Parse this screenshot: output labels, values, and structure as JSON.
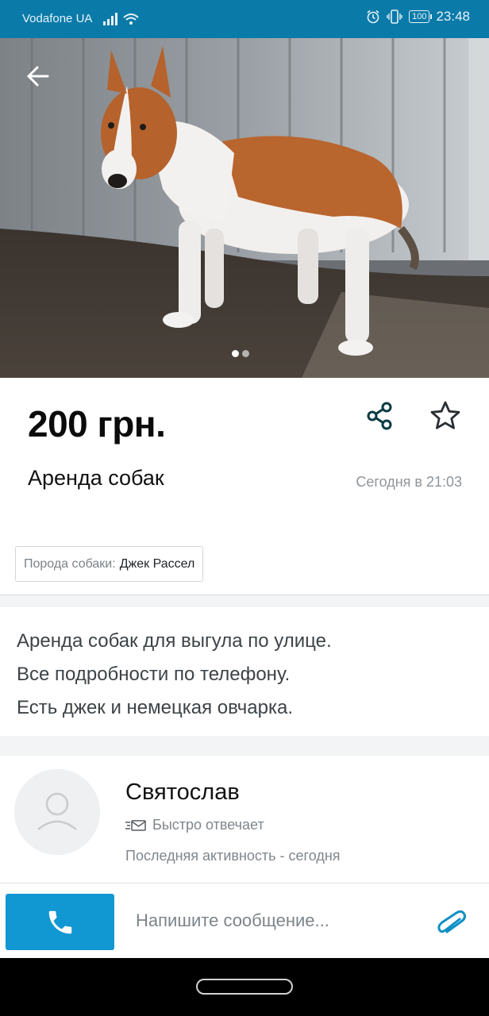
{
  "status_bar": {
    "carrier": "Vodafone UA",
    "battery": "100",
    "time": "23:48"
  },
  "photo": {
    "subject": "Jack Russell terrier dog standing in a yard by a metal fence",
    "page_count": 2,
    "current_page": 1
  },
  "listing": {
    "price": "200 грн.",
    "title": "Аренда собак",
    "date": "Сегодня в 21:03",
    "params": [
      {
        "key": "Порода собаки:",
        "value": "Джек Рассел"
      }
    ],
    "description": [
      "Аренда собак для выгула по улице.",
      "Все подробности по телефону.",
      "Есть джек и немецкая овчарка."
    ]
  },
  "seller": {
    "name": "Святослав",
    "badge": "Быстро отвечает",
    "activity": "Последняя активность - сегодня"
  },
  "message_bar": {
    "placeholder": "Напишите сообщение..."
  },
  "colors": {
    "status_bar": "#0a7aa9",
    "call_button": "#1197d1",
    "accent": "#0e8fc4",
    "share_icon": "#0b3a44"
  },
  "icons": {
    "back": "arrow-left",
    "share": "share-nodes",
    "favorite": "star-outline",
    "call": "phone",
    "attach": "paperclip",
    "badge": "fast-mail",
    "avatar": "user-placeholder"
  }
}
